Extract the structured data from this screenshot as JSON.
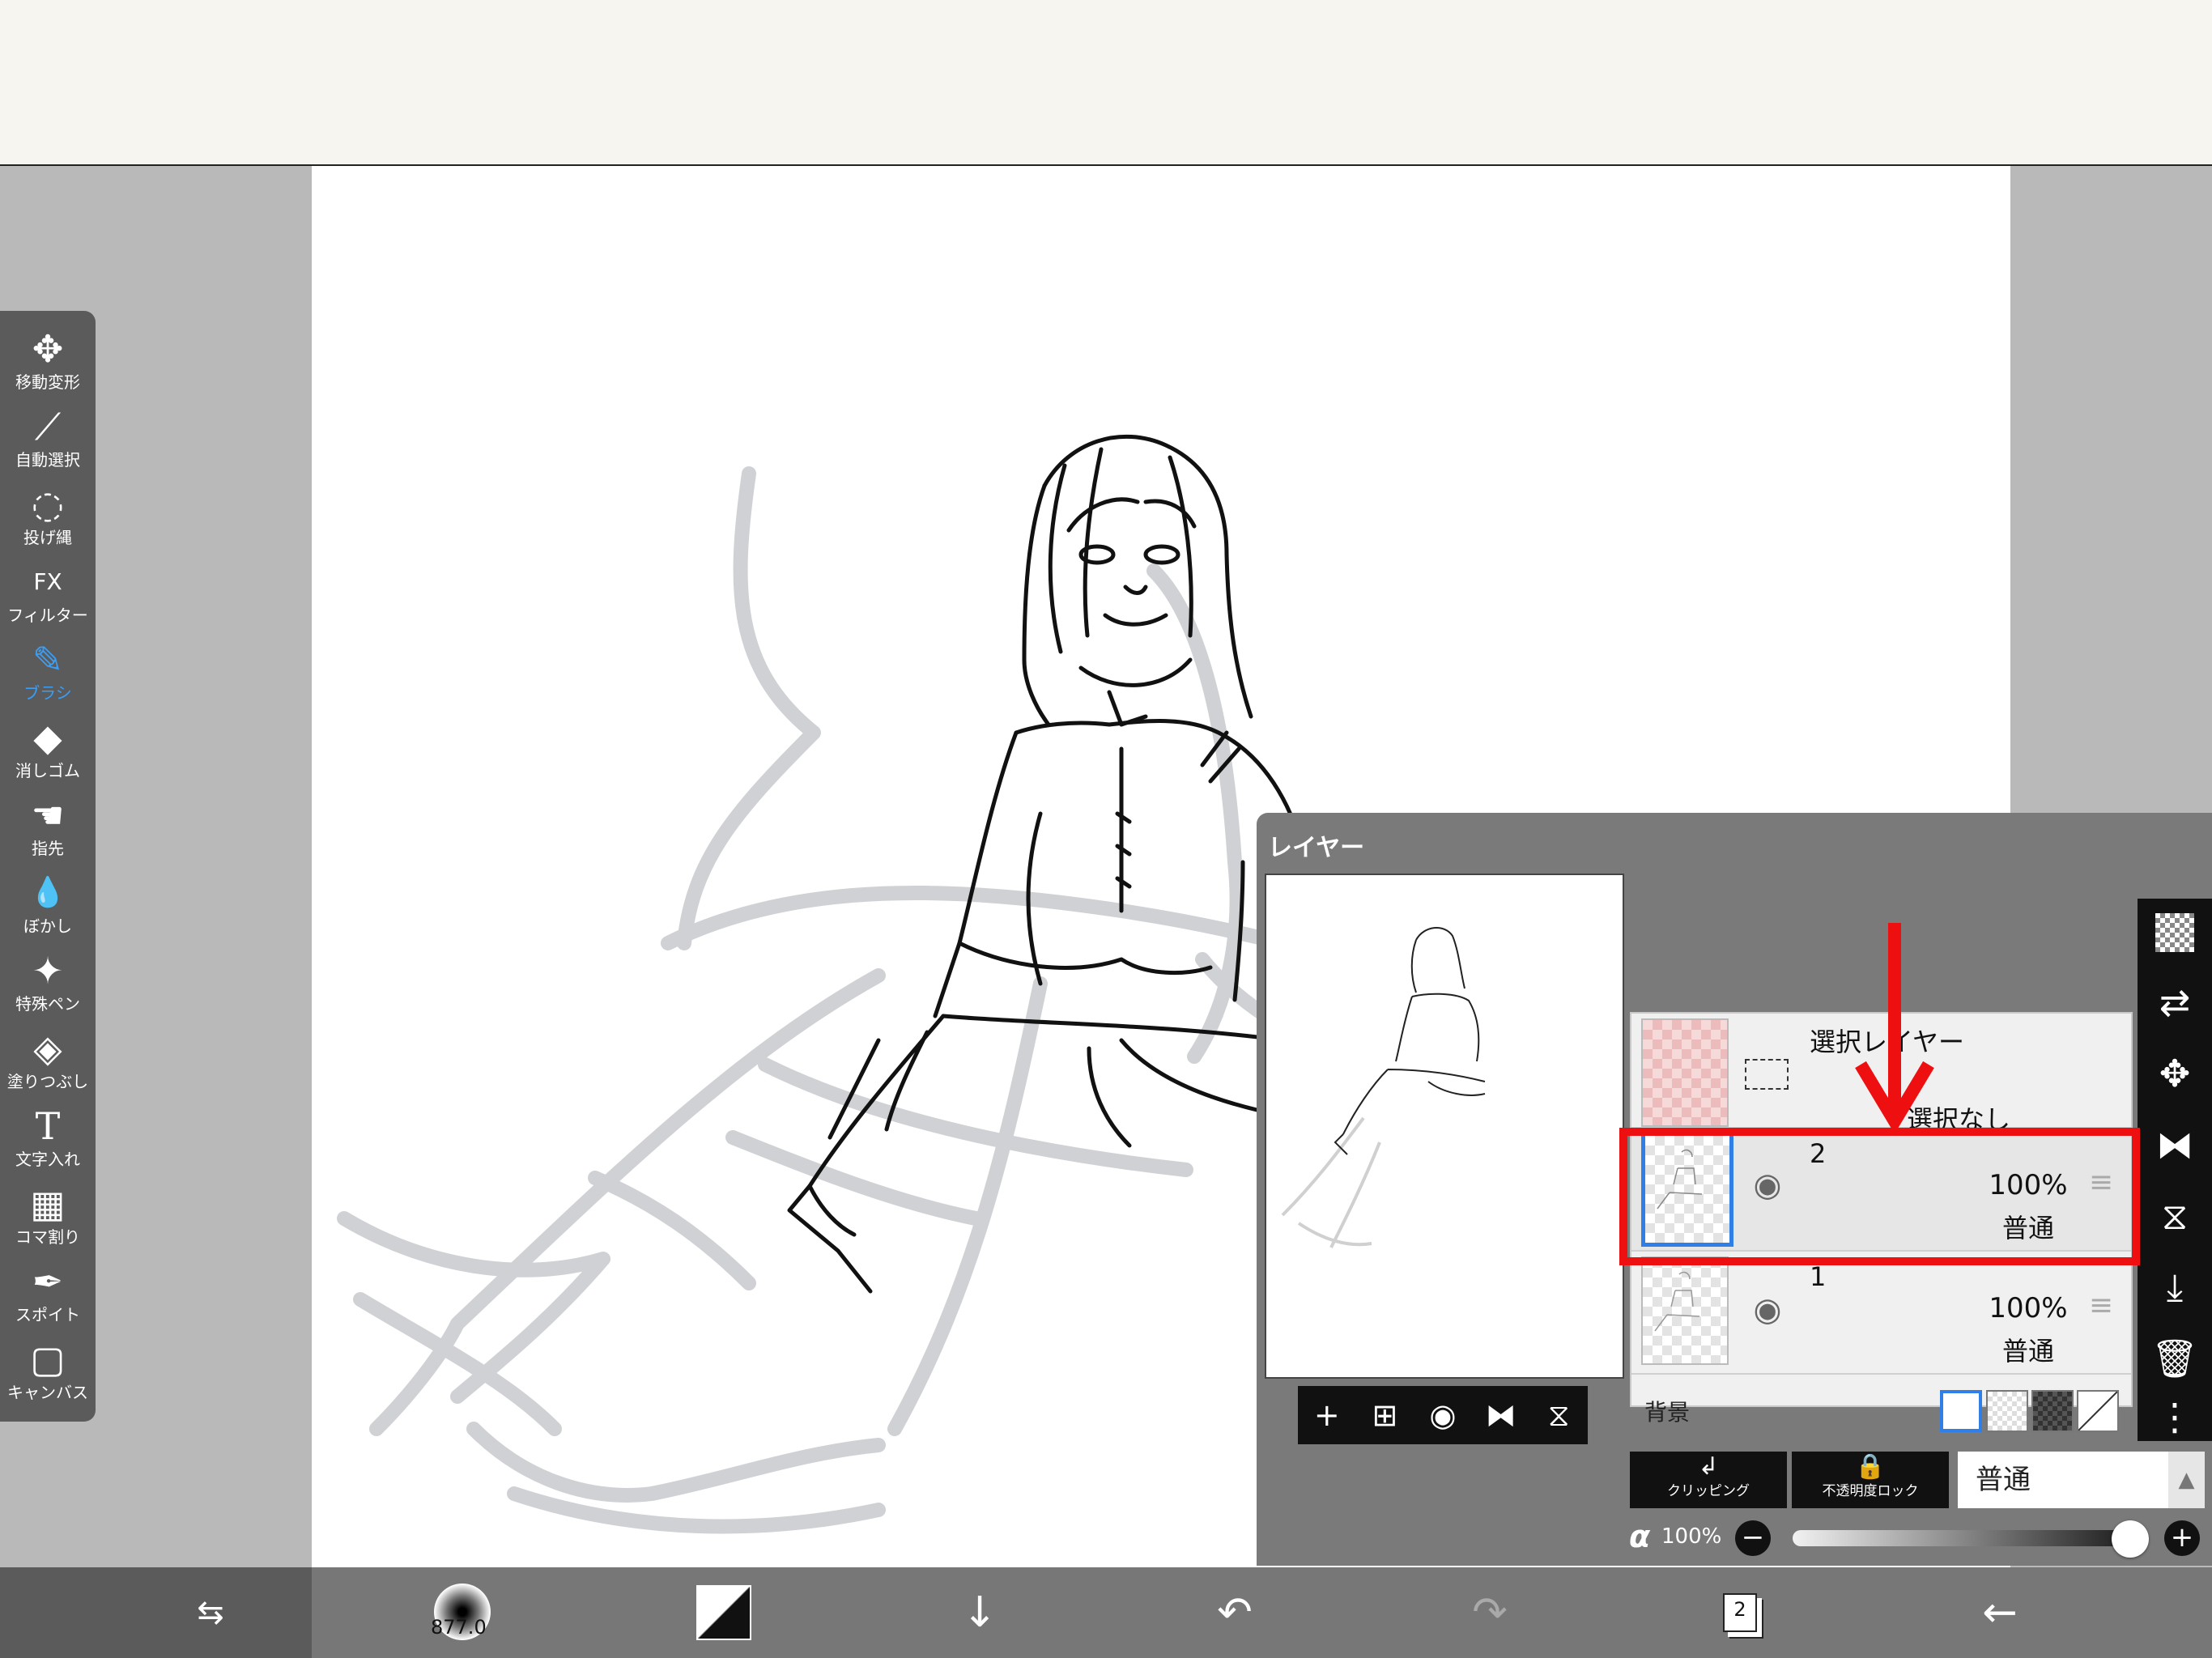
{
  "tools": [
    {
      "label": "移動変形",
      "icon": "move-transform-icon",
      "glyph": "✥"
    },
    {
      "label": "自動選択",
      "icon": "magic-wand-icon",
      "glyph": "⟋"
    },
    {
      "label": "投げ縄",
      "icon": "lasso-icon",
      "glyph": "◌"
    },
    {
      "label": "フィルター",
      "icon": "fx-filter-icon",
      "glyph": "FX"
    },
    {
      "label": "ブラシ",
      "icon": "brush-icon",
      "glyph": "✎",
      "active": true
    },
    {
      "label": "消しゴム",
      "icon": "eraser-icon",
      "glyph": "◆"
    },
    {
      "label": "指先",
      "icon": "finger-smudge-icon",
      "glyph": "☚"
    },
    {
      "label": "ぼかし",
      "icon": "blur-drop-icon",
      "glyph": "💧"
    },
    {
      "label": "特殊ペン",
      "icon": "special-pen-icon",
      "glyph": "✦"
    },
    {
      "label": "塗りつぶし",
      "icon": "fill-bucket-icon",
      "glyph": "◈"
    },
    {
      "label": "文字入れ",
      "icon": "text-icon",
      "glyph": "T"
    },
    {
      "label": "コマ割り",
      "icon": "frame-divider-icon",
      "glyph": "▦"
    },
    {
      "label": "スポイト",
      "icon": "eyedropper-icon",
      "glyph": "✒"
    },
    {
      "label": "キャンバス",
      "icon": "canvas-icon",
      "glyph": "▢"
    }
  ],
  "layer_panel": {
    "title": "レイヤー",
    "preview_tools": [
      "+",
      "⊞",
      "◉",
      "⧓",
      "⧖"
    ],
    "selection_layer": {
      "name": "選択レイヤー",
      "status": "選択なし"
    },
    "layers": [
      {
        "name": "2",
        "opacity": "100%",
        "mode": "普通",
        "selected": true
      },
      {
        "name": "1",
        "opacity": "100%",
        "mode": "普通",
        "selected": false
      }
    ],
    "background_label": "背景",
    "clipping_label": "クリッピング",
    "alpha_lock_label": "不透明度ロック",
    "blend_mode": "普通",
    "alpha_symbol": "α",
    "alpha_value": "100%",
    "alpha_fraction": 1.0,
    "minus": "−",
    "plus": "+"
  },
  "bottom_bar": {
    "brush_size": "877.0",
    "layer_count": "2"
  },
  "colors": {
    "accent": "#3c9df2",
    "highlight": "#ee1010",
    "selected_layer": "#2f7fe6"
  }
}
